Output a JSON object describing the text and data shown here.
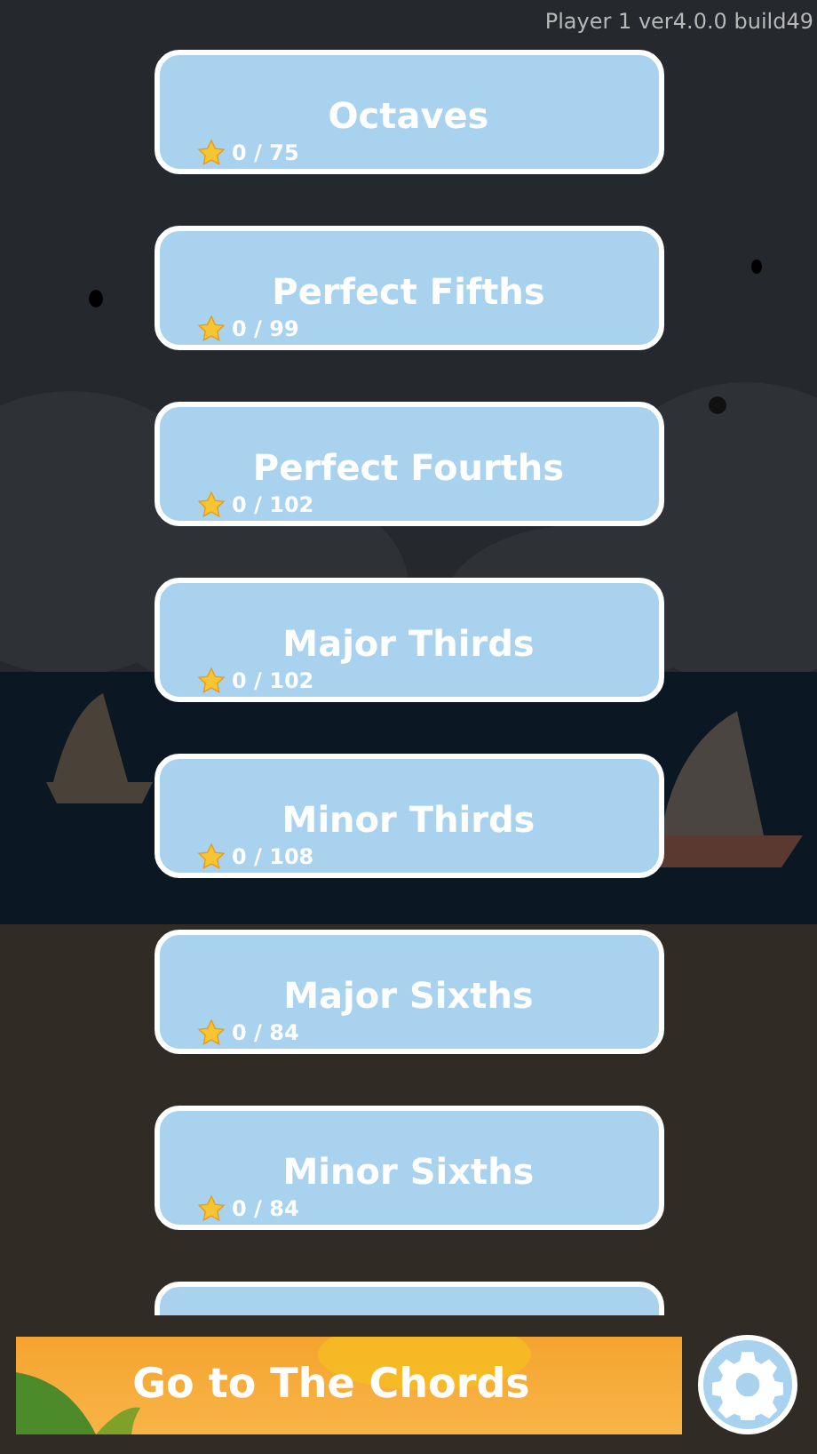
{
  "version_label": "Player 1 ver4.0.0 build49",
  "levels": [
    {
      "title": "Octaves",
      "score": "0 / 75"
    },
    {
      "title": "Perfect Fifths",
      "score": "0 / 99"
    },
    {
      "title": "Perfect Fourths",
      "score": "0 / 102"
    },
    {
      "title": "Major Thirds",
      "score": "0 / 102"
    },
    {
      "title": "Minor Thirds",
      "score": "0 / 108"
    },
    {
      "title": "Major Sixths",
      "score": "0 / 84"
    },
    {
      "title": "Minor Sixths",
      "score": "0 / 84"
    }
  ],
  "chords_button": {
    "label": "Go to The Chords"
  }
}
